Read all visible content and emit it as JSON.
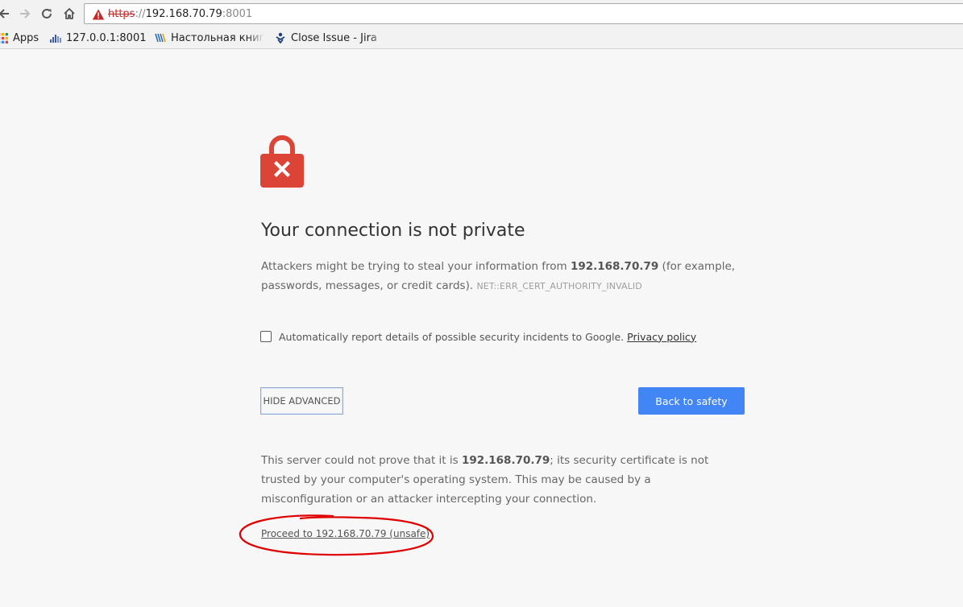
{
  "browser": {
    "address_bar": {
      "scheme": "https",
      "scheme_sep": "://",
      "host": "192.168.70.79",
      "port": ":8001"
    },
    "bookmarks": [
      {
        "label": "Apps",
        "icon": "apps-grid-icon"
      },
      {
        "label": "127.0.0.1:8001",
        "icon": "signal-bars-icon"
      },
      {
        "label": "Настольная книг",
        "icon": "book-icon"
      },
      {
        "label": "Close Issue - Jira",
        "icon": "jira-icon"
      }
    ]
  },
  "interstitial": {
    "heading": "Your connection is not private",
    "explanation": {
      "part1": "Attackers might be trying to steal your information from ",
      "host": "192.168.70.79",
      "part2": " (for example, passwords, messages, or credit cards).",
      "error_code": "NET::ERR_CERT_AUTHORITY_INVALID"
    },
    "report": {
      "label": "Automatically report details of possible security incidents to Google.",
      "link": "Privacy policy",
      "checked": false
    },
    "buttons": {
      "hide_advanced": "HIDE ADVANCED",
      "back_to_safety": "Back to safety"
    },
    "details": {
      "part1": "This server could not prove that it is ",
      "host": "192.168.70.79",
      "part2": "; its security certificate is not trusted by your computer's operating system. This may be caused by a misconfiguration or an attacker intercepting your connection."
    },
    "proceed_link": "Proceed to 192.168.70.79 (unsafe)"
  },
  "colors": {
    "primary_button": "#4285f4",
    "lock": "#db4437",
    "annotation_circle": "#e00000",
    "warning": "#c62828"
  }
}
